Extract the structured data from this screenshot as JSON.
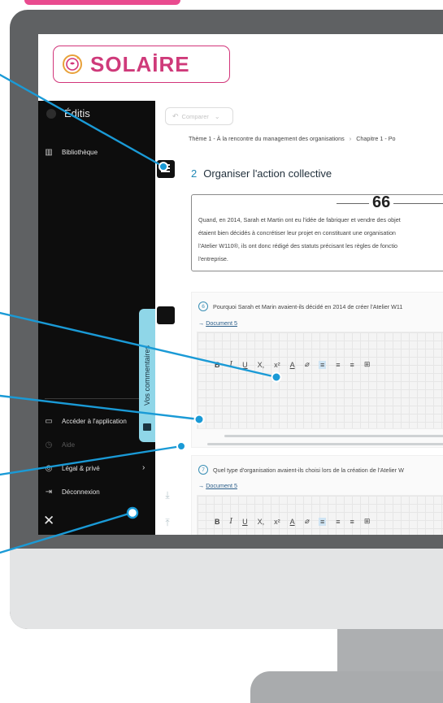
{
  "logo": {
    "text": "SOLAİRE",
    "color": "#cf3a7a"
  },
  "sidebar": {
    "brand": "Éditis",
    "items": [
      {
        "label": "Bibliothèque",
        "icon": "library-icon"
      },
      {
        "label": "Accéder à l'application",
        "icon": "app-icon"
      },
      {
        "label": "Aide",
        "icon": "help-icon"
      },
      {
        "label": "Légal & privé",
        "icon": "legal-icon"
      },
      {
        "label": "Déconnexion",
        "icon": "logout-icon"
      }
    ],
    "comments_tab": "Vos commentaires",
    "tab_color": "#8fd6e8"
  },
  "toolbar": {
    "compare_label": "Comparer"
  },
  "breadcrumb": {
    "theme": "Thème 1 - À la rencontre du management des organisations",
    "chapter": "Chapitre 1 - Po"
  },
  "section": {
    "number": "2",
    "title": "Organiser l'action collective"
  },
  "quote": {
    "mark": "66",
    "lines": [
      "Quand, en 2014, Sarah et Martin ont eu l'idée de fabriquer et vendre des objet",
      "étaient bien décidés à concrétiser leur projet en constituant une organisation",
      "l'Atelier W110®, ils ont donc rédigé des statuts précisant les règles de fonctio",
      "l'entreprise."
    ]
  },
  "questions": [
    {
      "number": "6",
      "text": "Pourquoi Sarah et Marin avaient-ils décidé en 2014 de créer l'Atelier W11",
      "doc_arrow": "→",
      "doc_link": "Document 5"
    },
    {
      "number": "7",
      "text": "Quel type d'organisation avaient-ils choisi lors de la création de l'Atelier W",
      "doc_arrow": "→",
      "doc_link": "Document 5"
    }
  ],
  "editor": {
    "bold": "B",
    "italic": "I",
    "underline": "U",
    "subscript": "X,",
    "superscript": "x²",
    "font_color": "A",
    "highlight": "⌀",
    "align_left": "≡",
    "align_center": "≡",
    "align_right": "≡",
    "table": "⊞"
  },
  "colors": {
    "accent": "#1f88b5",
    "callout": "#1a9ad6",
    "monitor": "#5f6163"
  }
}
